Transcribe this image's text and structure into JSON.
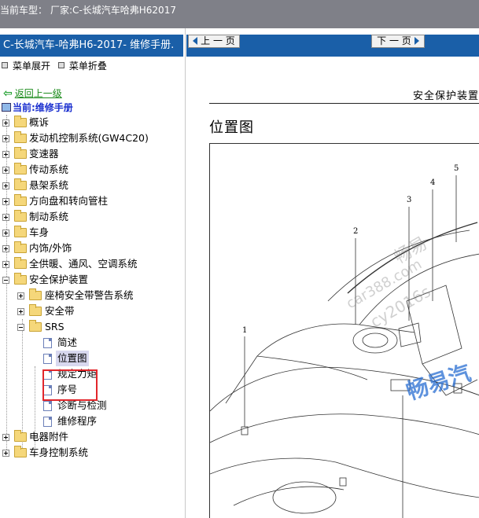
{
  "topbar": {
    "label": "当前车型：",
    "vehicle": "厂家:C-长城汽车哈弗H62017"
  },
  "sidebar": {
    "title": "C-长城汽车-哈弗H6-2017- 维修手册.",
    "expand_label": "菜单展开",
    "collapse_label": "菜单折叠",
    "back_label": "返回上一级",
    "current_label": "当前:维修手册",
    "tree": [
      {
        "label": "概诉"
      },
      {
        "label": "发动机控制系统(GW4C20)"
      },
      {
        "label": "变速器"
      },
      {
        "label": "传动系统"
      },
      {
        "label": "悬架系统"
      },
      {
        "label": "方向盘和转向管柱"
      },
      {
        "label": "制动系统"
      },
      {
        "label": "车身"
      },
      {
        "label": "内饰/外饰"
      },
      {
        "label": "全供暖、通风、空调系统"
      },
      {
        "label": "安全保护装置"
      },
      {
        "label": "座椅安全带警告系统"
      },
      {
        "label": "安全带"
      },
      {
        "label": "SRS"
      },
      {
        "label": "简述"
      },
      {
        "label": "位置图"
      },
      {
        "label": "规定力矩"
      },
      {
        "label": "序号"
      },
      {
        "label": "诊断与检测"
      },
      {
        "label": "维修程序"
      },
      {
        "label": "电器附件"
      },
      {
        "label": "车身控制系统"
      }
    ]
  },
  "content": {
    "prev_label": "上 一 页",
    "next_label": "下 一 页",
    "section_title": "安全保护装置",
    "page_title": "位置图",
    "callouts": [
      "1",
      "2",
      "3",
      "4",
      "5"
    ],
    "watermark_text": "畅易",
    "watermark_site": "cy2016s",
    "watermark_url": "car388.com",
    "watermark_blue": "畅易汽"
  },
  "colors": {
    "accent": "#1a5fa8",
    "highlight_box": "#e2262b",
    "back_link": "#1a8a1a"
  }
}
